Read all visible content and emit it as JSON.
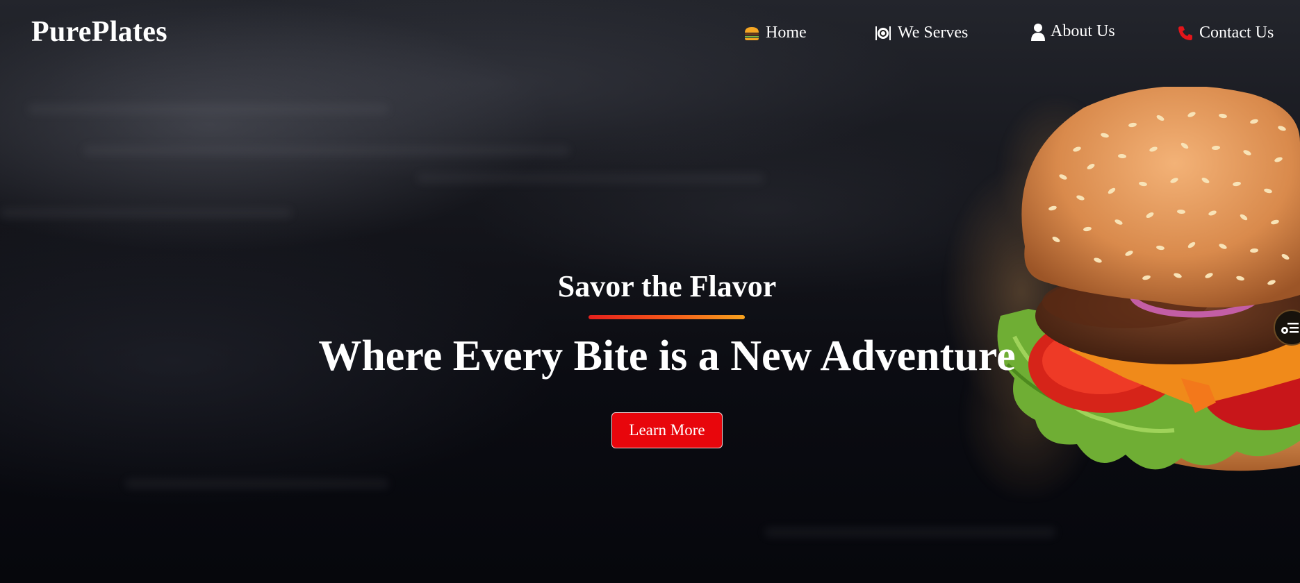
{
  "brand": {
    "name": "PurePlates"
  },
  "nav": {
    "items": [
      {
        "label": "Home",
        "icon": "burger-icon"
      },
      {
        "label": "We Serves",
        "icon": "plate-cutlery-icon"
      },
      {
        "label": "About Us",
        "icon": "user-icon"
      },
      {
        "label": "Contact Us",
        "icon": "phone-icon"
      }
    ]
  },
  "hero": {
    "tagline": "Savor the Flavor",
    "headline": "Where Every Bite is a New Adventure",
    "cta_label": "Learn More"
  },
  "side_widget": {
    "icon": "accessibility-menu-icon"
  },
  "colors": {
    "accent_red": "#e8060c",
    "underline_gradient": [
      "#e5201c",
      "#f7a21e"
    ],
    "phone_icon": "#e3151a",
    "text": "#ffffff"
  }
}
